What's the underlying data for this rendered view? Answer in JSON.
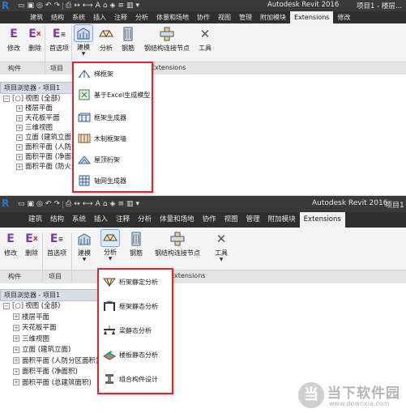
{
  "app": {
    "name": "Autodesk Revit 2016",
    "doc_name": "项目1 - 楼层...",
    "logo": "R"
  },
  "ribbon_tabs": [
    "建筑",
    "结构",
    "系统",
    "插入",
    "注释",
    "分析",
    "体量和场地",
    "协作",
    "视图",
    "管理",
    "附加模块",
    "Extensions",
    "修改"
  ],
  "active_tab": "Extensions",
  "ribbon": {
    "buttons": {
      "modify": "修改",
      "delete": "删除",
      "preferences": "首选项",
      "modeling": "建模",
      "analysis": "分析",
      "rebar": "钢筋",
      "steel_connection": "钢结构连接节点",
      "tools": "工具"
    },
    "groups": {
      "component": "构件",
      "project": "项目",
      "extensions": "Extensions"
    }
  },
  "browser": {
    "title": "项目浏览器 - 项目1",
    "root": "视图 (全部)",
    "items_top": [
      "楼层平面",
      "天花板平面",
      "三维视图",
      "立面 (建筑立面)",
      "面积平面 (人防分区面积)",
      "面积平面 (净面积)",
      "面积平面 (防火分区面积)"
    ],
    "items_bottom": [
      "楼层平面",
      "天花板平面",
      "三维视图",
      "立面 (建筑立面)",
      "面积平面 (人防分区面积)",
      "面积平面 (净面积)",
      "面积平面 (总建筑面积)"
    ]
  },
  "modeling_menu": [
    "梯框架",
    "基于Excel生成模型",
    "框架生成器",
    "木制框架墙",
    "屋顶桁架",
    "轴网生成器"
  ],
  "analysis_menu": [
    "桁架静定分析",
    "框架静态分析",
    "梁静态分析",
    "楼板静态分析",
    "组合构件设计"
  ],
  "watermark": {
    "logo": "当",
    "title": "当下软件园",
    "url": "www.downxia.com"
  },
  "colors": {
    "highlight_border": "#d9272e",
    "titlebar": "#3a3a3a",
    "tabbar": "#2f2f2f",
    "accent_purple": "#7c3aa8"
  }
}
